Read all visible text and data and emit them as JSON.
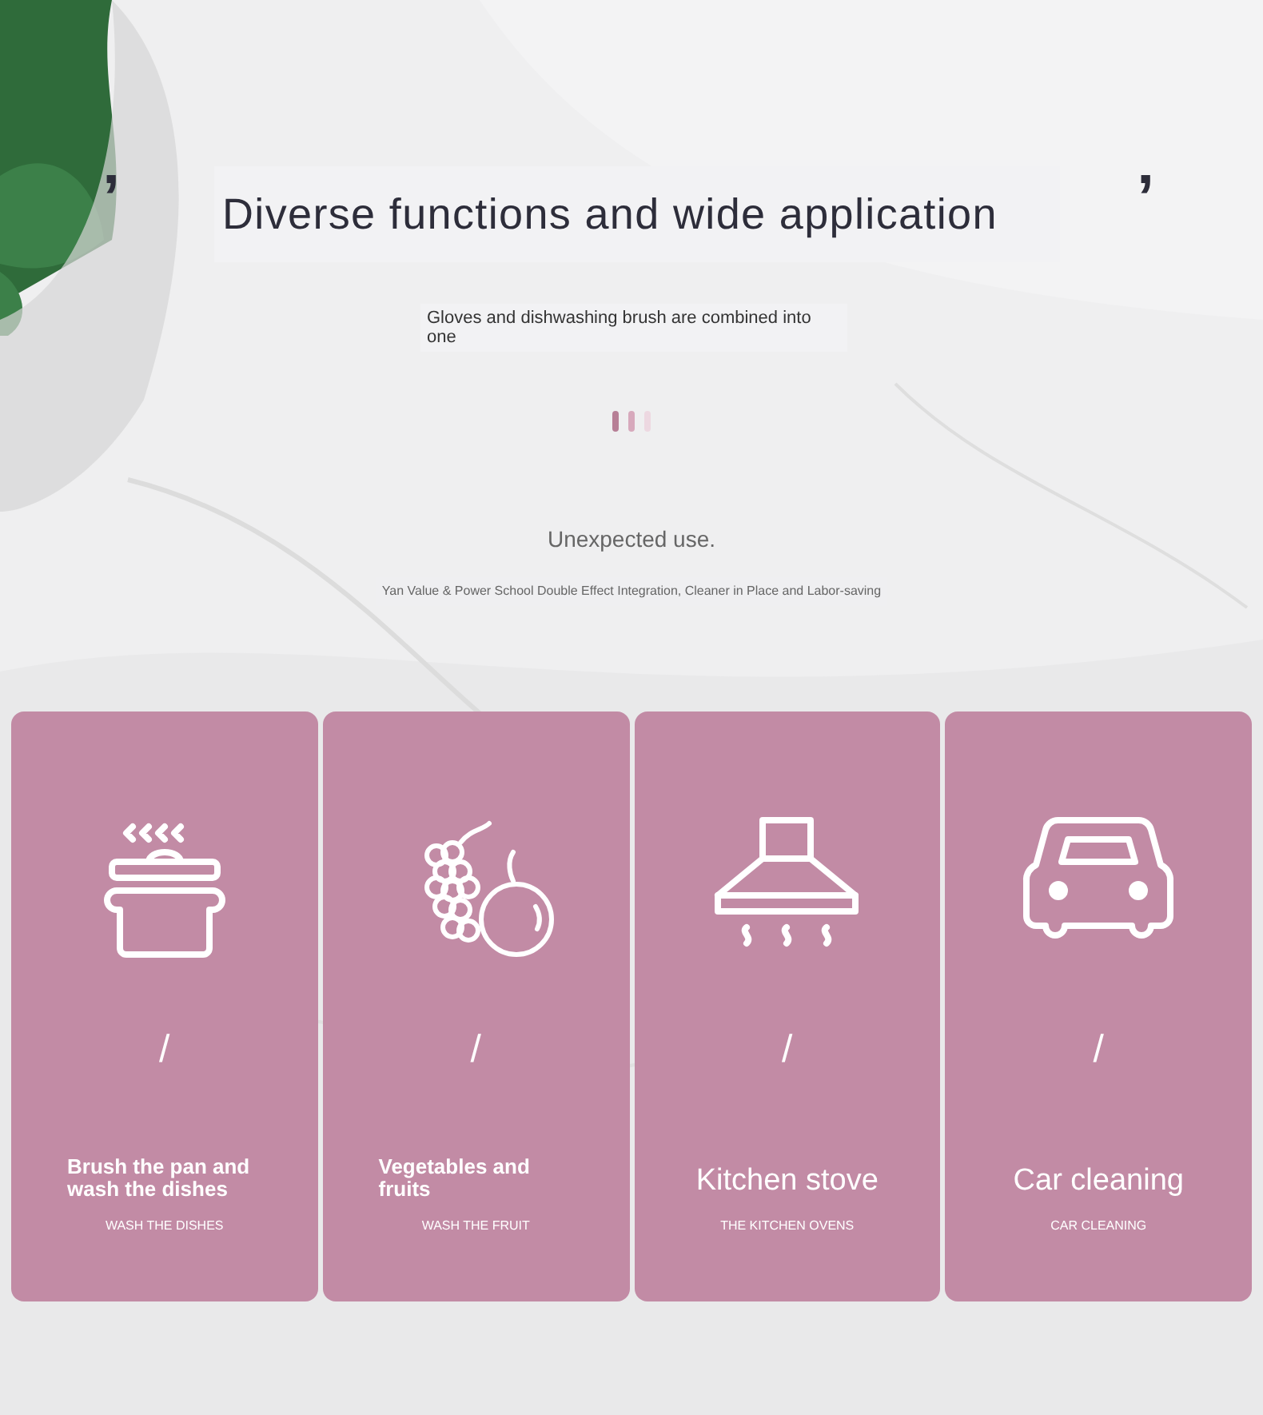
{
  "quote_open": "’",
  "quote_close": "’",
  "title": "Diverse functions and wide application",
  "subtitle": "Gloves and dishwashing brush are combined into one",
  "tagline": "Unexpected use.",
  "description": "Yan Value & Power School Double Effect Integration, Cleaner in Place and Labor-saving",
  "cards": [
    {
      "kind": "two-line",
      "title": "Brush the pan and wash the dishes",
      "separator": "/",
      "caption": "WASH THE DISHES"
    },
    {
      "kind": "two-line",
      "title": "Vegetables and fruits",
      "separator": "/",
      "caption": "WASH THE FRUIT"
    },
    {
      "kind": "one-line",
      "title": "Kitchen stove",
      "separator": "/",
      "caption": "THE KITCHEN OVENS"
    },
    {
      "kind": "one-line",
      "title": "Car cleaning",
      "separator": "/",
      "caption": "CAR CLEANING"
    }
  ]
}
